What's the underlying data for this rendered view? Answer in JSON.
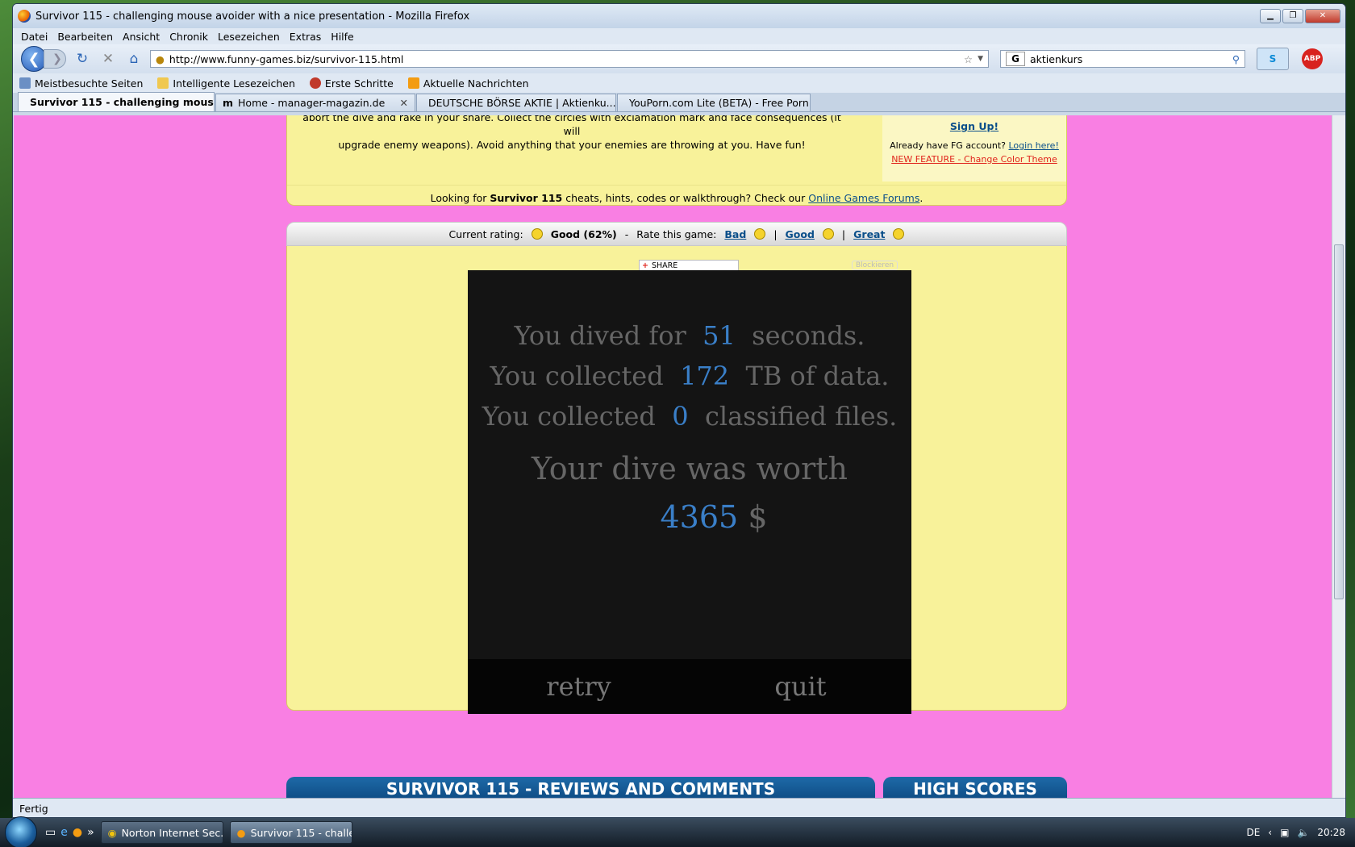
{
  "window": {
    "title": "Survivor 115 - challenging mouse avoider with a nice presentation - Mozilla Firefox"
  },
  "menu": [
    "Datei",
    "Bearbeiten",
    "Ansicht",
    "Chronik",
    "Lesezeichen",
    "Extras",
    "Hilfe"
  ],
  "nav": {
    "url": "http://www.funny-games.biz/survivor-115.html",
    "search_value": "aktienkurs",
    "search_engine": "G"
  },
  "bookmarks": [
    "Meistbesuchte Seiten",
    "Intelligente Lesezeichen",
    "Erste Schritte",
    "Aktuelle Nachrichten"
  ],
  "tabs": [
    {
      "label": "Survivor 115 - challenging mouse...",
      "active": true
    },
    {
      "label": "Home - manager-magazin.de",
      "active": false
    },
    {
      "label": "DEUTSCHE BÖRSE AKTIE | Aktienku...",
      "active": false
    },
    {
      "label": "YouPorn.com Lite (BETA) - Free Porn",
      "active": false
    }
  ],
  "page": {
    "desc_line1": "abort the dive and rake in your share. Collect the circles with exclamation mark and face consequences (it will",
    "desc_line2": "upgrade enemy weapons). Avoid anything that your enemies are throwing at you. Have fun!",
    "signup": "Sign Up!",
    "already": "Already have FG account?",
    "login": "Login here!",
    "newfeature": "NEW FEATURE - Change Color Theme",
    "cheat_pre": "Looking for",
    "cheat_game": "Survivor 115",
    "cheat_mid": "cheats, hints, codes or walkthrough? Check our",
    "cheat_link": "Online Games Forums",
    "cheat_end": "."
  },
  "rating": {
    "label": "Current rating:",
    "value": "Good (62%)",
    "dash": "-",
    "rate": "Rate this game:",
    "bad": "Bad",
    "good": "Good",
    "great": "Great",
    "sep": "|"
  },
  "share": {
    "label": "SHARE",
    "block": "Blockieren"
  },
  "game": {
    "dived_pre": "You dived for",
    "dived_val": "51",
    "dived_post": "seconds.",
    "data_pre": "You collected",
    "data_val": "172",
    "data_post": "TB of data.",
    "files_pre": "You collected",
    "files_val": "0",
    "files_post": "classified files.",
    "worth": "Your dive was worth",
    "amount": "4365",
    "currency": "$",
    "retry": "retry",
    "quit": "quit"
  },
  "sections": {
    "reviews": "SURVIVOR 115 - REVIEWS AND COMMENTS",
    "highscores": "HIGH SCORES"
  },
  "status": "Fertig",
  "taskbar": {
    "items": [
      "Norton Internet Sec...",
      "Survivor 115 - challe..."
    ],
    "lang": "DE",
    "time": "20:28"
  }
}
